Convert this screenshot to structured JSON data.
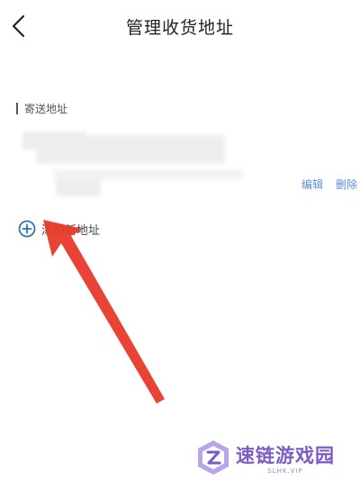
{
  "header": {
    "title": "管理收货地址"
  },
  "section": {
    "label": "寄送地址"
  },
  "address": {
    "edit_label": "编辑",
    "delete_label": "删除"
  },
  "add_address": {
    "label": "添加新地址"
  },
  "watermark": {
    "name": "速链游戏园",
    "domain": "SLHK.VIP"
  },
  "icons": {
    "back": "chevron-left-icon",
    "add": "plus-circle-icon",
    "annotation": "red-arrow-icon",
    "logo": "site-logo-icon"
  },
  "colors": {
    "link": "#5b8fd6",
    "add_icon": "#2f76b8",
    "arrow": "#e8392b",
    "watermark": "#7b5bc6"
  }
}
